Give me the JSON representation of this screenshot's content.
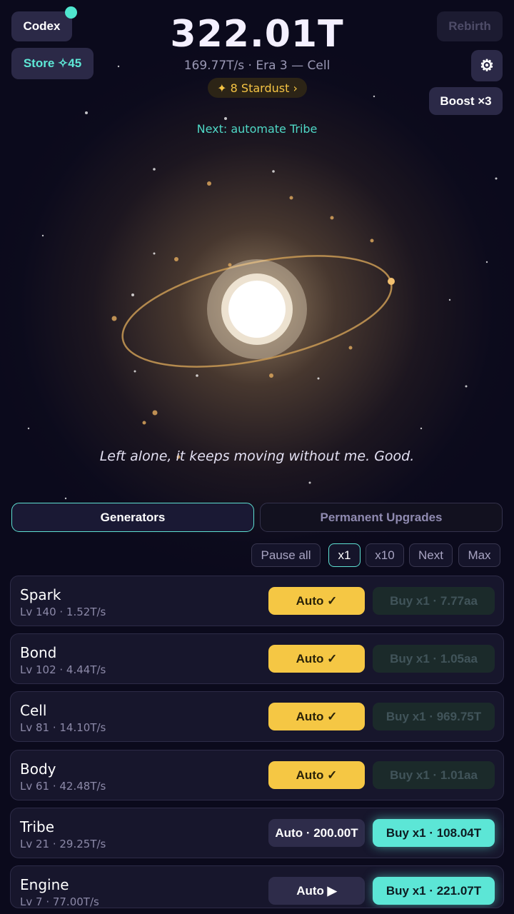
{
  "header": {
    "codex_label": "Codex",
    "store_label": "Store ✧45",
    "rebirth_label": "Rebirth",
    "boost_label": "Boost ×3",
    "score": "322.01T",
    "rate": "169.77T/s · Era 3 — Cell",
    "stardust": "✦ 8 Stardust ›",
    "next_hint": "Next: automate Tribe"
  },
  "quote": "Left alone, it keeps moving without me. Good.",
  "tabs": {
    "generators": "Generators",
    "upgrades": "Permanent Upgrades"
  },
  "controls": {
    "pause_all": "Pause all",
    "x1": "x1",
    "x10": "x10",
    "next": "Next",
    "max": "Max"
  },
  "generators": [
    {
      "name": "Spark",
      "stats": "Lv 140 · 1.52T/s",
      "auto": "Auto ✓",
      "buy": "Buy x1 · 7.77aa"
    },
    {
      "name": "Bond",
      "stats": "Lv 102 · 4.44T/s",
      "auto": "Auto ✓",
      "buy": "Buy x1 · 1.05aa"
    },
    {
      "name": "Cell",
      "stats": "Lv 81 · 14.10T/s",
      "auto": "Auto ✓",
      "buy": "Buy x1 · 969.75T"
    },
    {
      "name": "Body",
      "stats": "Lv 61 · 42.48T/s",
      "auto": "Auto ✓",
      "buy": "Buy x1 · 1.01aa"
    },
    {
      "name": "Tribe",
      "stats": "Lv 21 · 29.25T/s",
      "auto": "Auto · 200.00T",
      "buy": "Buy x1 · 108.04T"
    },
    {
      "name": "Engine",
      "stats": "Lv 7 · 77.00T/s",
      "auto": "Auto ▶",
      "buy": "Buy x1 · 221.07T"
    }
  ],
  "colors": {
    "accent": "#5ee0d2",
    "gold": "#f5c744",
    "background": "#0b0a1c"
  }
}
